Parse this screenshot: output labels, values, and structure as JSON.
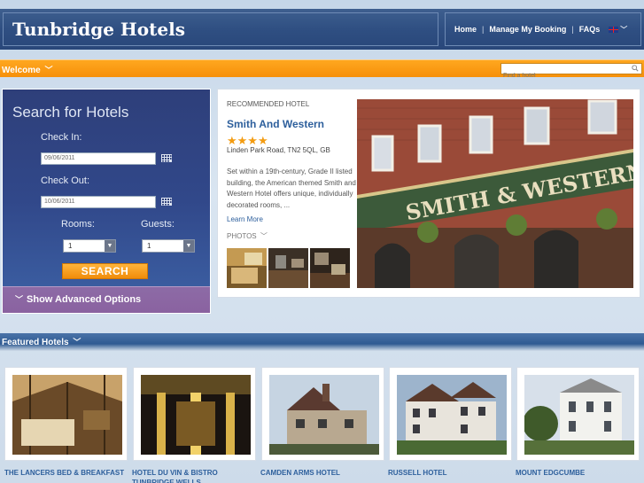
{
  "header": {
    "brand": "Tunbridge Hotels",
    "nav": {
      "home": "Home",
      "manage": "Manage My Booking",
      "faqs": "FAQs",
      "separator": "|"
    },
    "language_icon": "uk-flag-icon"
  },
  "welcome": {
    "label": "Welcome",
    "search_placeholder": "Find a hotel"
  },
  "search": {
    "title": "Search for Hotels",
    "check_in_label": "Check In:",
    "check_in_value": "09/06/2011",
    "check_out_label": "Check Out:",
    "check_out_value": "10/06/2011",
    "rooms_label": "Rooms:",
    "rooms_value": "1",
    "guests_label": "Guests:",
    "guests_value": "1",
    "button": "SEARCH",
    "advanced": "Show Advanced Options"
  },
  "recommended": {
    "kicker": "RECOMMENDED HOTEL",
    "name": "Smith And Western",
    "stars": "★★★★",
    "address": "Linden Park Road, TN2 5QL, GB",
    "description": "Set within a 19th-century, Grade II listed building, the American themed Smith and Western Hotel offers unique, individually decorated rooms, ...",
    "more": "Learn More",
    "photos": "PHOTOS",
    "sign_text": "SMITH & WESTERN"
  },
  "featured": {
    "label": "Featured Hotels",
    "hotels": [
      {
        "name": "THE LANCERS BED & BREAKFAST"
      },
      {
        "name": "HOTEL DU VIN & BISTRO TUNBRIDGE WELLS"
      },
      {
        "name": "CAMDEN ARMS HOTEL"
      },
      {
        "name": "RUSSELL HOTEL"
      },
      {
        "name": "MOUNT EDGCUMBE"
      }
    ]
  },
  "colors": {
    "header_blue": "#2f4f82",
    "accent_orange": "#f6900a",
    "link_blue": "#2d5f9c",
    "advanced_purple": "#8d6ba6"
  }
}
